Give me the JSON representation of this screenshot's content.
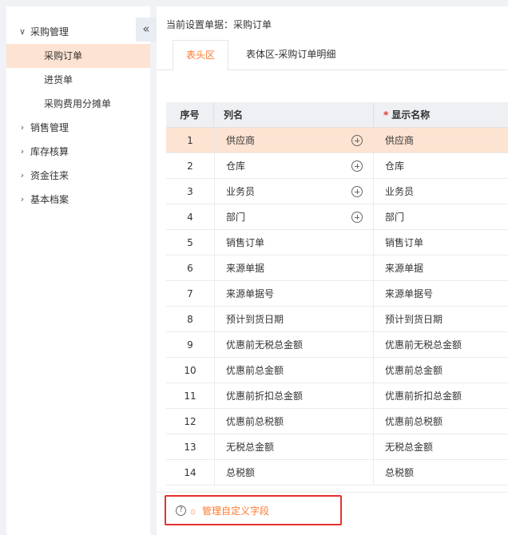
{
  "sidebar": {
    "collapse_icon": "double-chevron-left-icon",
    "groups": [
      {
        "label": "采购管理",
        "expanded": true,
        "chevron": "∨"
      },
      {
        "label": "销售管理",
        "expanded": false,
        "chevron": "›"
      },
      {
        "label": "库存核算",
        "expanded": false,
        "chevron": "›"
      },
      {
        "label": "资金往来",
        "expanded": false,
        "chevron": "›"
      },
      {
        "label": "基本档案",
        "expanded": false,
        "chevron": "›"
      }
    ],
    "sub_items": [
      {
        "label": "采购订单",
        "active": true
      },
      {
        "label": "进货单",
        "active": false
      },
      {
        "label": "采购费用分摊单",
        "active": false
      }
    ]
  },
  "main": {
    "setting_prefix": "当前设置单据：",
    "setting_doc": "采购订单",
    "tabs": [
      {
        "label": "表头区",
        "active": true
      },
      {
        "label": "表体区-采购订单明细",
        "active": false
      }
    ],
    "table": {
      "headers": {
        "index": "序号",
        "column": "列名",
        "required_mark": "*",
        "display": "显示名称"
      },
      "rows": [
        {
          "index": "1",
          "column": "供应商",
          "display": "供应商",
          "add": true,
          "active": true
        },
        {
          "index": "2",
          "column": "仓库",
          "display": "仓库",
          "add": true
        },
        {
          "index": "3",
          "column": "业务员",
          "display": "业务员",
          "add": true
        },
        {
          "index": "4",
          "column": "部门",
          "display": "部门",
          "add": true
        },
        {
          "index": "5",
          "column": "销售订单",
          "display": "销售订单"
        },
        {
          "index": "6",
          "column": "来源单据",
          "display": "来源单据"
        },
        {
          "index": "7",
          "column": "来源单据号",
          "display": "来源单据号"
        },
        {
          "index": "8",
          "column": "预计到货日期",
          "display": "预计到货日期"
        },
        {
          "index": "9",
          "column": "优惠前无税总金额",
          "display": "优惠前无税总金额"
        },
        {
          "index": "10",
          "column": "优惠前总金额",
          "display": "优惠前总金额"
        },
        {
          "index": "11",
          "column": "优惠前折扣总金额",
          "display": "优惠前折扣总金额"
        },
        {
          "index": "12",
          "column": "优惠前总税额",
          "display": "优惠前总税额"
        },
        {
          "index": "13",
          "column": "无税总金额",
          "display": "无税总金额"
        },
        {
          "index": "14",
          "column": "总税额",
          "display": "总税额"
        }
      ]
    },
    "footer": {
      "help_glyph": "?",
      "gear_glyph": "۞",
      "manage_label": "管理自定义字段"
    }
  },
  "colors": {
    "accent": "#ff7a2e",
    "active_row": "#fde3d2",
    "highlight_box": "#e5322d"
  }
}
